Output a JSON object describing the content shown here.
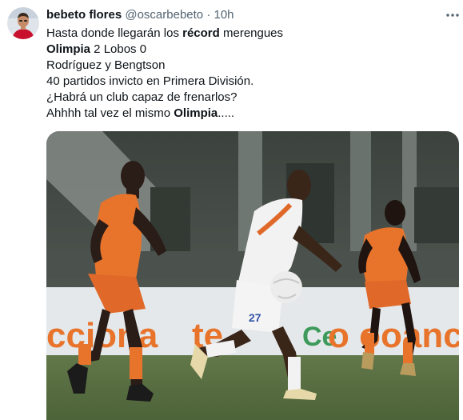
{
  "tweet": {
    "author_name": "bebeto flores",
    "author_handle": "@oscarbebeto",
    "separator": "·",
    "time": "10h",
    "more_icon": "more-horizontal-icon",
    "lines": [
      {
        "parts": [
          {
            "text": "Hasta donde llegarán los ",
            "bold": false
          },
          {
            "text": "récord",
            "bold": true
          },
          {
            "text": " merengues",
            "bold": false
          }
        ]
      },
      {
        "parts": [
          {
            "text": "Olimpia",
            "bold": true
          },
          {
            "text": " 2 Lobos 0",
            "bold": false
          }
        ]
      },
      {
        "parts": [
          {
            "text": "Rodríguez y Bengtson",
            "bold": false
          }
        ]
      },
      {
        "parts": [
          {
            "text": "40 partidos invicto en Primera División.",
            "bold": false
          }
        ]
      },
      {
        "parts": [
          {
            "text": "¿Habrá un club capaz de frenarlos?",
            "bold": false
          }
        ]
      },
      {
        "parts": [
          {
            "text": "Ahhhh tal vez el mismo ",
            "bold": false
          },
          {
            "text": "Olimpia",
            "bold": true
          },
          {
            "text": ".....",
            "bold": false
          }
        ]
      }
    ]
  },
  "photo": {
    "board_text_left": "cciona",
    "board_text_mid": "te",
    "board_text_right": "o ooanc",
    "board_logo_text": "Ce",
    "jersey_number_center": "27"
  },
  "colors": {
    "text": "#0f1419",
    "secondary": "#536471",
    "orange_kit": "#e8742c",
    "white_kit": "#f2f2f2"
  }
}
